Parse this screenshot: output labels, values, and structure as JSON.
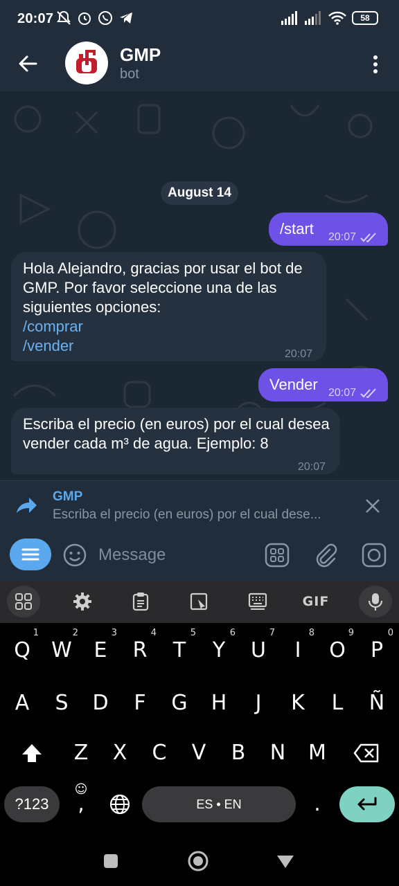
{
  "status_bar": {
    "time": "20:07",
    "battery": "58"
  },
  "header": {
    "title": "GMP",
    "subtitle": "bot"
  },
  "chat": {
    "date_chip": "August 14",
    "messages": [
      {
        "direction": "out",
        "text": "/start",
        "time": "20:07",
        "status": "read"
      },
      {
        "direction": "in",
        "text": "Hola Alejandro, gracias por usar el bot de GMP. Por favor seleccione una de las siguientes opciones:",
        "links": [
          "/comprar",
          "/vender"
        ],
        "time": "20:07"
      },
      {
        "direction": "out",
        "text": "Vender",
        "time": "20:07",
        "status": "read"
      },
      {
        "direction": "in",
        "text": "Escriba el precio (en euros) por el cual desea vender cada m³ de agua. Ejemplo: 8",
        "time": "20:07"
      }
    ]
  },
  "reply": {
    "name": "GMP",
    "text": "Escriba el precio (en euros) por el cual dese..."
  },
  "composer": {
    "placeholder": "Message",
    "value": ""
  },
  "keyboard": {
    "toolbar": [
      "apps-icon",
      "gear-icon",
      "clipboard-icon",
      "resize-icon",
      "keyboard-icon",
      "GIF",
      "mic-icon"
    ],
    "gif_label": "GIF",
    "row1": [
      {
        "k": "Q",
        "h": "1"
      },
      {
        "k": "W",
        "h": "2"
      },
      {
        "k": "E",
        "h": "3"
      },
      {
        "k": "R",
        "h": "4"
      },
      {
        "k": "T",
        "h": "5"
      },
      {
        "k": "Y",
        "h": "6"
      },
      {
        "k": "U",
        "h": "7"
      },
      {
        "k": "I",
        "h": "8"
      },
      {
        "k": "O",
        "h": "9"
      },
      {
        "k": "P",
        "h": "0"
      }
    ],
    "row2": [
      "A",
      "S",
      "D",
      "F",
      "G",
      "H",
      "J",
      "K",
      "L",
      "Ñ"
    ],
    "row3": [
      "Z",
      "X",
      "C",
      "V",
      "B",
      "N",
      "M"
    ],
    "symbols_label": "?123",
    "comma_label": ",",
    "space_label": "ES • EN",
    "period_label": "."
  },
  "colors": {
    "outgoing": "#6e52e8",
    "incoming": "#25313f",
    "link": "#6cb2f2",
    "header": "#212d3b",
    "chat_bg": "#1b2733",
    "accent": "#5aa9ee",
    "enter_key": "#7fd1c2"
  }
}
